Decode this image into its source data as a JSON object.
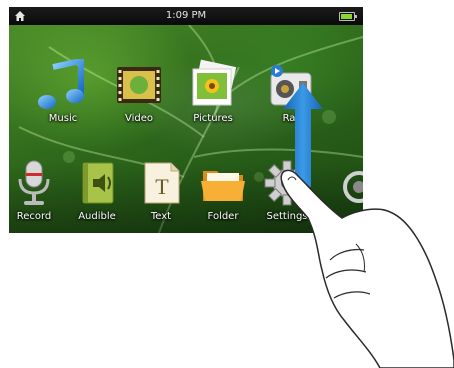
{
  "status": {
    "time": "1:09 PM",
    "home_icon": "home-icon",
    "battery_icon": "battery-icon"
  },
  "apps_top": [
    {
      "label": "Music",
      "icon": "music-note-icon"
    },
    {
      "label": "Video",
      "icon": "film-strip-icon"
    },
    {
      "label": "Pictures",
      "icon": "photo-icon"
    },
    {
      "label": "Ra",
      "icon": "radio-icon"
    }
  ],
  "apps_bottom": [
    {
      "label": "Record",
      "icon": "microphone-icon"
    },
    {
      "label": "Audible",
      "icon": "audible-book-icon"
    },
    {
      "label": "Text",
      "icon": "text-document-icon"
    },
    {
      "label": "Folder",
      "icon": "folder-icon"
    },
    {
      "label": "Settings",
      "icon": "gear-icon"
    }
  ],
  "gesture": {
    "direction": "up",
    "icons": [
      "swipe-up-arrow-icon",
      "finger-hand-icon"
    ]
  },
  "colors": {
    "arrow": "#1e78c8",
    "wallpaper": "#2f6a1c",
    "status_bar": "#111111"
  }
}
